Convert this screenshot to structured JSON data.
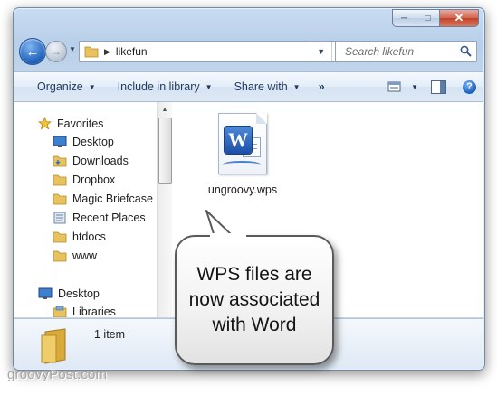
{
  "window": {
    "caption": {
      "minimize": "─",
      "maximize": "□",
      "close": "✕"
    },
    "address": {
      "path": "likefun",
      "refresh_glyph": "↻"
    },
    "search": {
      "placeholder": "Search likefun"
    },
    "toolbar": {
      "organize": "Organize",
      "include_in_library": "Include in library",
      "share_with": "Share with",
      "more": "»",
      "help": "?"
    },
    "nav_pane": {
      "favorites": "Favorites",
      "items": [
        "Desktop",
        "Downloads",
        "Dropbox",
        "Magic Briefcase",
        "Recent Places",
        "htdocs",
        "www"
      ],
      "desktop": "Desktop",
      "libraries": "Libraries"
    },
    "content": {
      "file_name": "ungroovy.wps",
      "badge_letter": "W"
    },
    "details": {
      "item_count": "1 item"
    }
  },
  "callout": {
    "text": "WPS files are\nnow associated\nwith Word"
  },
  "watermark": "groovyPost.com",
  "colors": {
    "accent": "#1e395b",
    "window_frame": "#c4d6ec",
    "folder": "#e8c25c"
  }
}
